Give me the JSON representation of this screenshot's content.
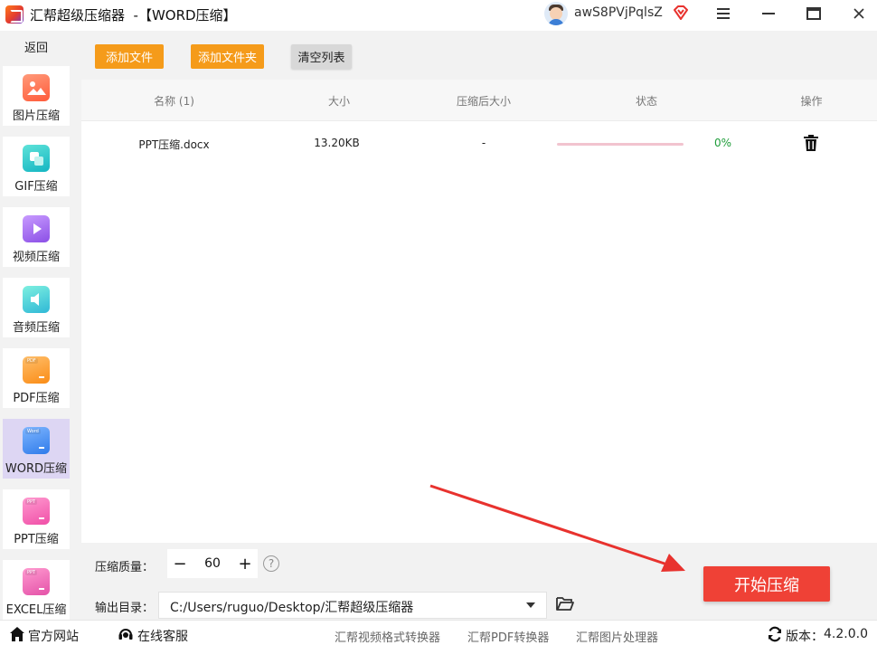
{
  "window": {
    "title": "汇帮超级压缩器  -【WORD压缩】",
    "username": "awS8PVjPqlsZ",
    "icons": [
      "app-logo",
      "user-avatar",
      "vip-diamond-icon",
      "menu-icon",
      "minimize-icon",
      "maximize-icon",
      "close-icon"
    ]
  },
  "sidebar": {
    "back_label": "返回",
    "items": [
      {
        "label": "图片压缩",
        "icon": "image-icon",
        "color": "#ff6b4a",
        "active": false
      },
      {
        "label": "GIF压缩",
        "icon": "gif-icon",
        "color": "#13c2c2",
        "active": false
      },
      {
        "label": "视频压缩",
        "icon": "video-icon",
        "color": "#9254de",
        "active": false
      },
      {
        "label": "音频压缩",
        "icon": "audio-icon",
        "color": "#36cfc9",
        "active": false
      },
      {
        "label": "PDF压缩",
        "icon": "pdf-icon",
        "color": "#fa8c16",
        "active": false
      },
      {
        "label": "WORD压缩",
        "icon": "word-icon",
        "color": "#2f7bea",
        "active": true
      },
      {
        "label": "PPT压缩",
        "icon": "ppt-icon",
        "color": "#f759ab",
        "active": false
      },
      {
        "label": "EXCEL压缩",
        "icon": "excel-icon",
        "color": "#eb5fae",
        "active": false
      }
    ],
    "doc_tags": {
      "pdf": "PDF",
      "word": "Word",
      "ppt": "PPT",
      "excel": "PPT"
    }
  },
  "toolbar": {
    "add_file": "添加文件",
    "add_folder": "添加文件夹",
    "clear_list": "清空列表"
  },
  "table": {
    "headers": {
      "name": "名称 (1)",
      "size": "大小",
      "compressed_size": "压缩后大小",
      "status": "状态",
      "action": "操作"
    },
    "rows": [
      {
        "name": "PPT压缩.docx",
        "size": "13.20KB",
        "compressed_size": "-",
        "progress": 0,
        "progress_text": "0%"
      }
    ]
  },
  "settings": {
    "quality_label": "压缩质量：",
    "quality_value": "60",
    "minus": "−",
    "plus": "+",
    "help": "?",
    "output_label": "输出目录：",
    "output_path": "C:/Users/ruguo/Desktop/汇帮超级压缩器"
  },
  "start_button": "开始压缩",
  "footer": {
    "website": "官方网站",
    "support": "在线客服",
    "link1": "汇帮视频格式转换器",
    "link2": "汇帮PDF转换器",
    "link3": "汇帮图片处理器",
    "version_label": "版本：",
    "version": "4.2.0.0"
  },
  "colors": {
    "accent_orange": "#f59b1a",
    "start_red": "#ef4136",
    "active_purple": "#ddd6f3",
    "progress_pink": "#f2c4cf",
    "percent_green": "#1f9d3a",
    "arrow_red": "#e8322e"
  }
}
